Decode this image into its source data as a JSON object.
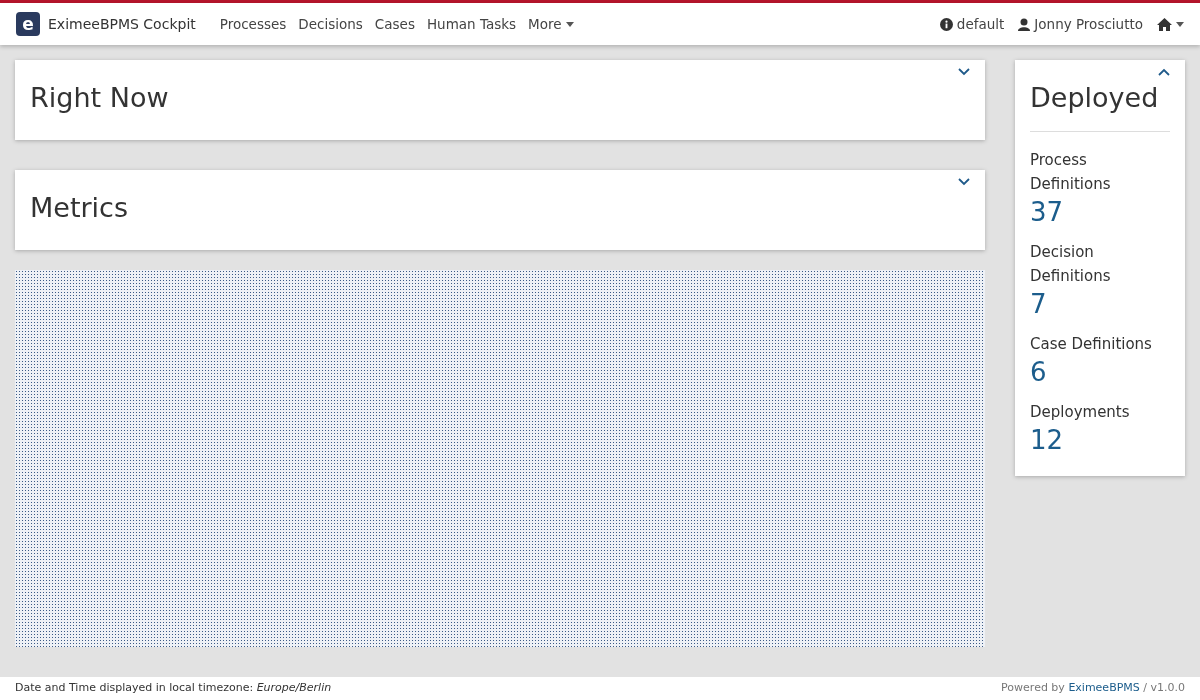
{
  "navbar": {
    "logo_letter": "e",
    "brand": "EximeeBPMS Cockpit",
    "menu": [
      {
        "label": "Processes"
      },
      {
        "label": "Decisions"
      },
      {
        "label": "Cases"
      },
      {
        "label": "Human Tasks"
      },
      {
        "label": "More",
        "dropdown": true
      }
    ],
    "engine": "default",
    "user": "Jonny Prosciutto"
  },
  "sections": [
    {
      "title": "Right Now",
      "expanded": false
    },
    {
      "title": "Metrics",
      "expanded": false
    }
  ],
  "deployed": {
    "title": "Deployed",
    "expanded": true,
    "items": [
      {
        "label": "Process Definitions",
        "value": "37"
      },
      {
        "label": "Decision Definitions",
        "value": "7"
      },
      {
        "label": "Case Definitions",
        "value": "6"
      },
      {
        "label": "Deployments",
        "value": "12"
      }
    ]
  },
  "footer": {
    "timezone_note": "Date and Time displayed in local timezone: *Europe/Berlin*",
    "powered_by": "Powered by",
    "powered_link": "EximeeBPMS",
    "version": "/ v1.0.0"
  }
}
